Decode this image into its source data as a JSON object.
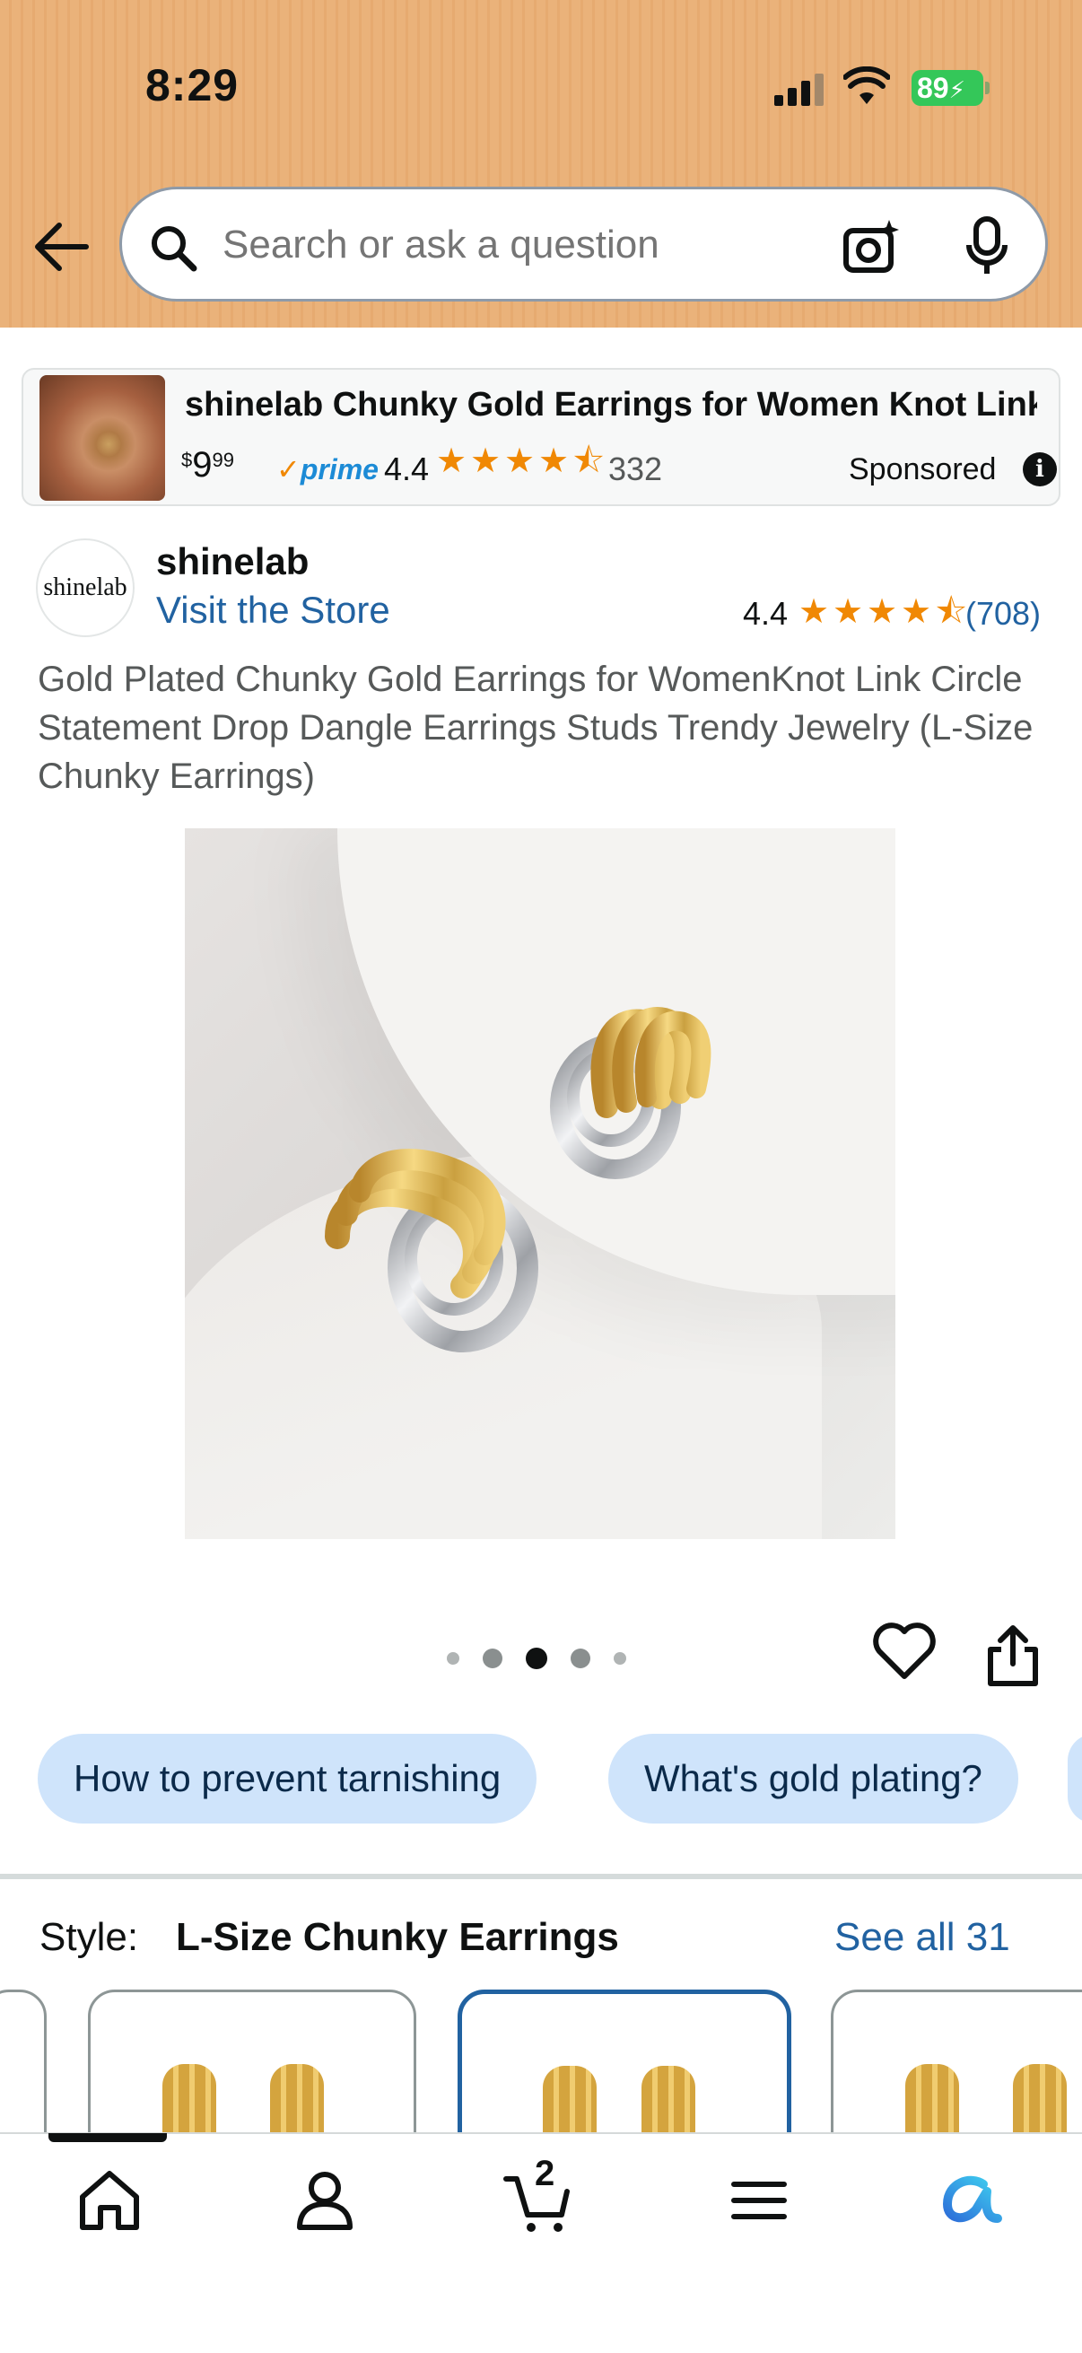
{
  "status_bar": {
    "time": "8:29",
    "battery": "89"
  },
  "search": {
    "placeholder": "Search or ask a question"
  },
  "sponsored": {
    "title": "shinelab Chunky Gold Earrings for Women Knot Link...",
    "price_dollars": "9",
    "price_cents": "99",
    "price_symbol": "$",
    "prime": "prime",
    "rating": "4.4",
    "review_count": "332",
    "label": "Sponsored"
  },
  "store": {
    "logo_text": "shinelab",
    "name": "shinelab",
    "visit_label": "Visit the Store",
    "rating": "4.4",
    "review_count": "(708)"
  },
  "product": {
    "title": "Gold Plated Chunky Gold Earrings for WomenKnot Link Circle Statement Drop Dangle Earrings Studs Trendy Jewelry (L-Size Chunky Earrings)",
    "image_count": 5,
    "active_image_index": 2
  },
  "chips": [
    "How to prevent tarnishing",
    "What's gold plating?"
  ],
  "style": {
    "label": "Style:",
    "value": "L-Size Chunky Earrings",
    "see_all": "See all 31"
  },
  "bottom_nav": {
    "items": [
      "home-icon",
      "account-icon",
      "cart-icon",
      "menu-icon",
      "rufus-icon"
    ],
    "cart_count": "2"
  },
  "colors": {
    "header_bg": "#eab27a",
    "link": "#2162a1",
    "star": "#f08804",
    "chip_bg": "#cfe4fb",
    "prime_blue": "#1c8bd6"
  }
}
